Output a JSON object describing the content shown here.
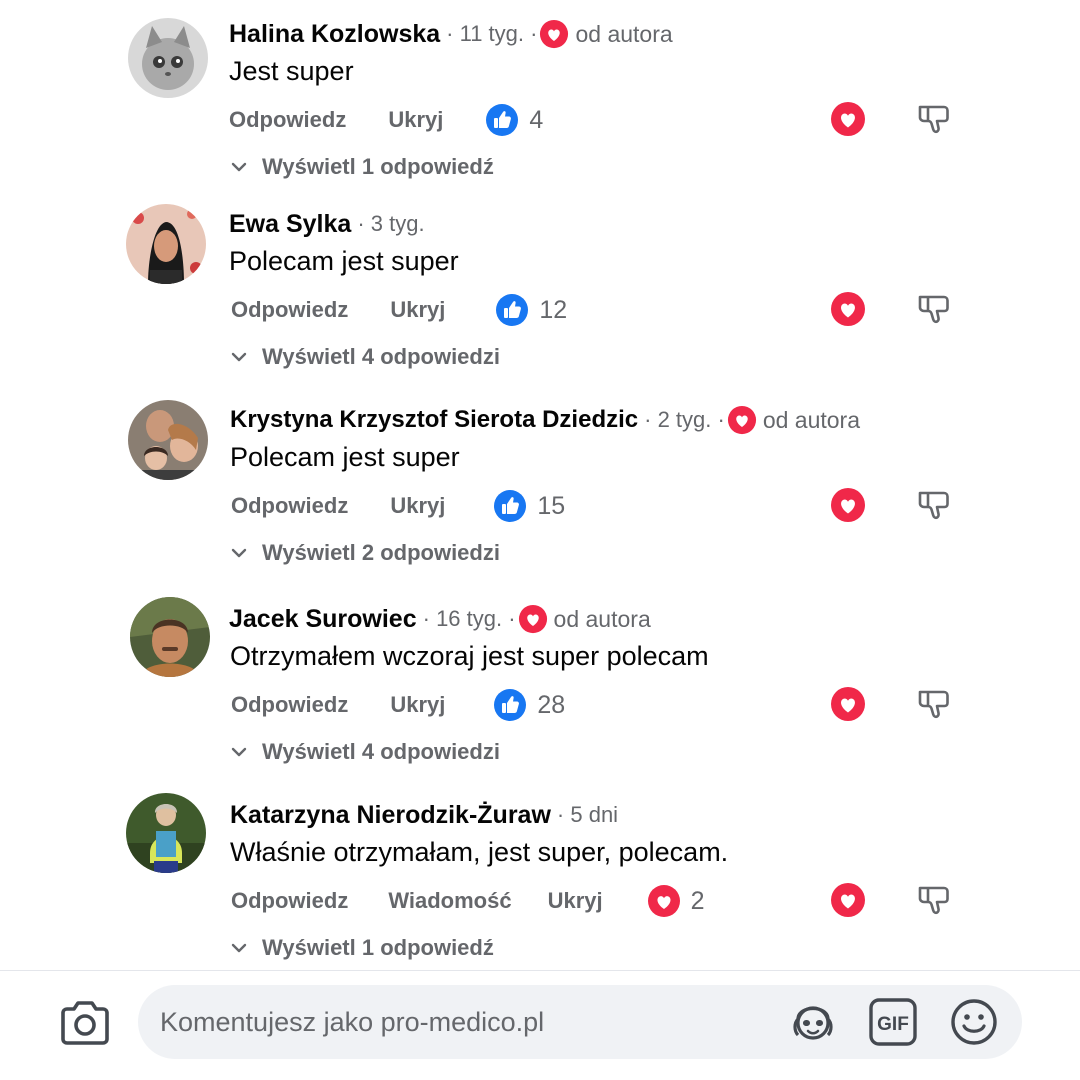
{
  "comments": [
    {
      "name": "Halina Kozlowska",
      "time": "· 11 tyg. ·",
      "author_badge": "od autora",
      "text": "Jest super",
      "reply_label": "Odpowiedz",
      "hide_label": "Ukryj",
      "reaction_icon": "like-icon",
      "reaction_count": "4",
      "view_replies": "Wyświetl 1 odpowiedź"
    },
    {
      "name": "Ewa Sylka",
      "time": "· 3 tyg.",
      "text": "Polecam jest super",
      "reply_label": "Odpowiedz",
      "hide_label": "Ukryj",
      "reaction_icon": "like-icon",
      "reaction_count": "12",
      "view_replies": "Wyświetl 4 odpowiedzi"
    },
    {
      "name": "Krystyna Krzysztof Sierota Dziedzic",
      "time": "· 2 tyg. ·",
      "author_badge": "od autora",
      "text": "Polecam jest super",
      "reply_label": "Odpowiedz",
      "hide_label": "Ukryj",
      "reaction_icon": "like-icon",
      "reaction_count": "15",
      "view_replies": "Wyświetl 2 odpowiedzi"
    },
    {
      "name": "Jacek Surowiec",
      "time": "· 16 tyg. ·",
      "author_badge": "od autora",
      "text": "Otrzymałem wczoraj jest super polecam",
      "reply_label": "Odpowiedz",
      "hide_label": "Ukryj",
      "reaction_icon": "like-icon",
      "reaction_count": "28",
      "view_replies": "Wyświetl 4 odpowiedzi"
    },
    {
      "name": "Katarzyna Nierodzik-Żuraw",
      "time": "· 5 dni",
      "text": "Właśnie otrzymałam, jest super, polecam.",
      "reply_label": "Odpowiedz",
      "message_label": "Wiadomość",
      "hide_label": "Ukryj",
      "reaction_icon": "love-icon",
      "reaction_count": "2",
      "view_replies": "Wyświetl 1 odpowiedź"
    }
  ],
  "composer": {
    "placeholder": "Komentujesz jako pro-medico.pl",
    "icons": [
      "camera-icon",
      "avatar-sticker-icon",
      "gif-icon",
      "emoji-icon"
    ]
  },
  "colors": {
    "like_blue": "#1877f2",
    "love_red": "#f02849",
    "text_secondary": "#65676b",
    "input_bg": "#f0f2f5"
  }
}
